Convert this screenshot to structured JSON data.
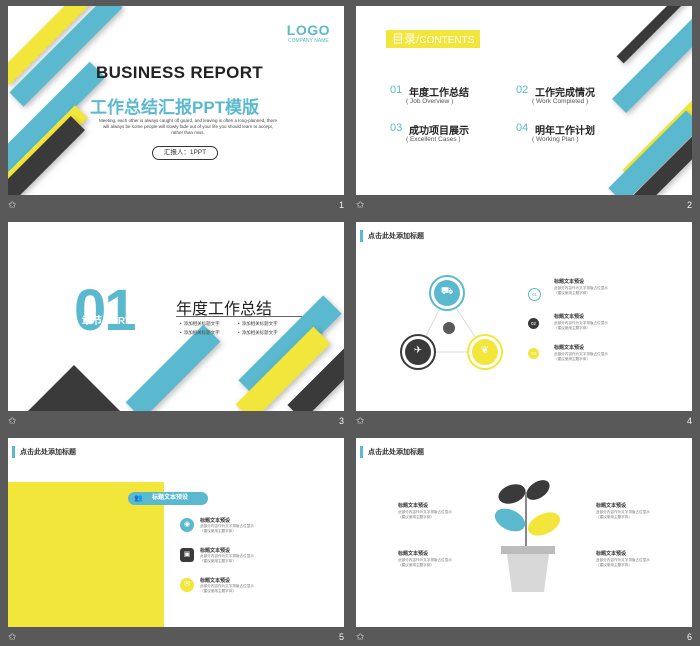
{
  "slides": [
    {
      "logo": "LOGO",
      "company": "COMPANY NAME",
      "title": "BUSINESS REPORT",
      "subtitle": "工作总结汇报PPT模版",
      "para": "Meeting, each other is always caught off guard, and leaving is often a long-planned, there will always be some people will slowly fade out of your life you should learn to accept, rather than miss.",
      "reporter": "汇报人：1PPT",
      "number": "1"
    },
    {
      "heading_cn": "目录",
      "heading_sep": "/",
      "heading_en": "CONTENTS",
      "items": [
        {
          "num": "01",
          "title": "年度工作总结",
          "en": "( Job Overview )"
        },
        {
          "num": "02",
          "title": "工作完成情况",
          "en": "( Work Completed )"
        },
        {
          "num": "03",
          "title": "成功项目展示",
          "en": "( Excellent Cases )"
        },
        {
          "num": "04",
          "title": "明年工作计划",
          "en": "( Working Plan )"
        }
      ],
      "number": "2"
    },
    {
      "big_num": "01",
      "chapter_part": "章节 PART",
      "chapter_title": "年度工作总结",
      "bullets": [
        "添加相关标题文字",
        "添加相关标题文字",
        "添加相关标题文字",
        "添加相关标题文字"
      ],
      "number": "3"
    },
    {
      "header": "点击此处添加标题",
      "list": [
        {
          "n": "01",
          "title": "标题文本预设",
          "desc1": "此部分内容作为文字排版占位显示",
          "desc2": "（建议使用主题字体）"
        },
        {
          "n": "02",
          "title": "标题文本预设",
          "desc1": "此部分内容作为文字排版占位显示",
          "desc2": "（建议使用主题字体）"
        },
        {
          "n": "03",
          "title": "标题文本预设",
          "desc1": "此部分内容作为文字排版占位显示",
          "desc2": "（建议使用主题字体）"
        }
      ],
      "number": "4"
    },
    {
      "header": "点击此处添加标题",
      "pill": "标题文本预设",
      "list": [
        {
          "title": "标题文本预设",
          "desc1": "此部分内容作为文字排版占位显示",
          "desc2": "（建议使用主题字体）"
        },
        {
          "title": "标题文本预设",
          "desc1": "此部分内容作为文字排版占位显示",
          "desc2": "（建议使用主题字体）"
        },
        {
          "title": "标题文本预设",
          "desc1": "此部分内容作为文字排版占位显示",
          "desc2": "（建议使用主题字体）"
        }
      ],
      "number": "5"
    },
    {
      "header": "点击此处添加标题",
      "blocks": [
        {
          "title": "标题文本预设",
          "desc1": "此部分内容作为文字排版占位显示",
          "desc2": "（建议使用主题字体）"
        },
        {
          "title": "标题文本预设",
          "desc1": "此部分内容作为文字排版占位显示",
          "desc2": "（建议使用主题字体）"
        },
        {
          "title": "标题文本预设",
          "desc1": "此部分内容作为文字排版占位显示",
          "desc2": "（建议使用主题字体）"
        },
        {
          "title": "标题文本预设",
          "desc1": "此部分内容作为文字排版占位显示",
          "desc2": "（建议使用主题字体）"
        }
      ],
      "number": "6"
    }
  ],
  "colors": {
    "teal": "#5bb9cf",
    "yellow": "#f2e63a",
    "dark": "#3a3a3a",
    "background": "#595959"
  },
  "icons": {
    "footer": "star-icon",
    "s4_top": "truck-icon",
    "s4_left": "plane-icon",
    "s4_right": "leaf-icon",
    "s4_center": "globe-icon"
  }
}
